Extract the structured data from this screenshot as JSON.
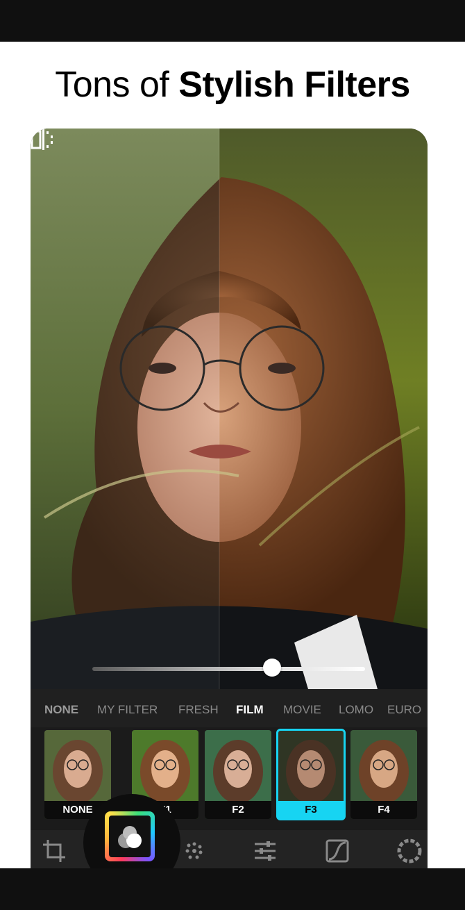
{
  "headline": {
    "light": "Tons of ",
    "bold": "Stylish Filters"
  },
  "slider": {
    "value_fraction": 0.66
  },
  "filter_tabs": [
    {
      "label": "NONE",
      "state": "none"
    },
    {
      "label": "MY FILTER",
      "state": "inactive"
    },
    {
      "label": "FRESH",
      "state": "inactive"
    },
    {
      "label": "FILM",
      "state": "active"
    },
    {
      "label": "MOVIE",
      "state": "inactive"
    },
    {
      "label": "LOMO",
      "state": "inactive"
    },
    {
      "label": "EURO",
      "state": "inactive"
    }
  ],
  "thumbnails": [
    {
      "label": "NONE"
    },
    {
      "label": "F1"
    },
    {
      "label": "F2"
    },
    {
      "label": "F3",
      "selected": true
    },
    {
      "label": "F4"
    }
  ],
  "toolbar": {
    "tools": [
      "crop-icon",
      "filters-icon",
      "dots-effect-icon",
      "adjust-sliders-icon",
      "curves-icon",
      "vignette-icon"
    ]
  },
  "colors": {
    "accent": "#17d4f2",
    "background": "#ffffff",
    "panel": "#1b1b1b"
  }
}
